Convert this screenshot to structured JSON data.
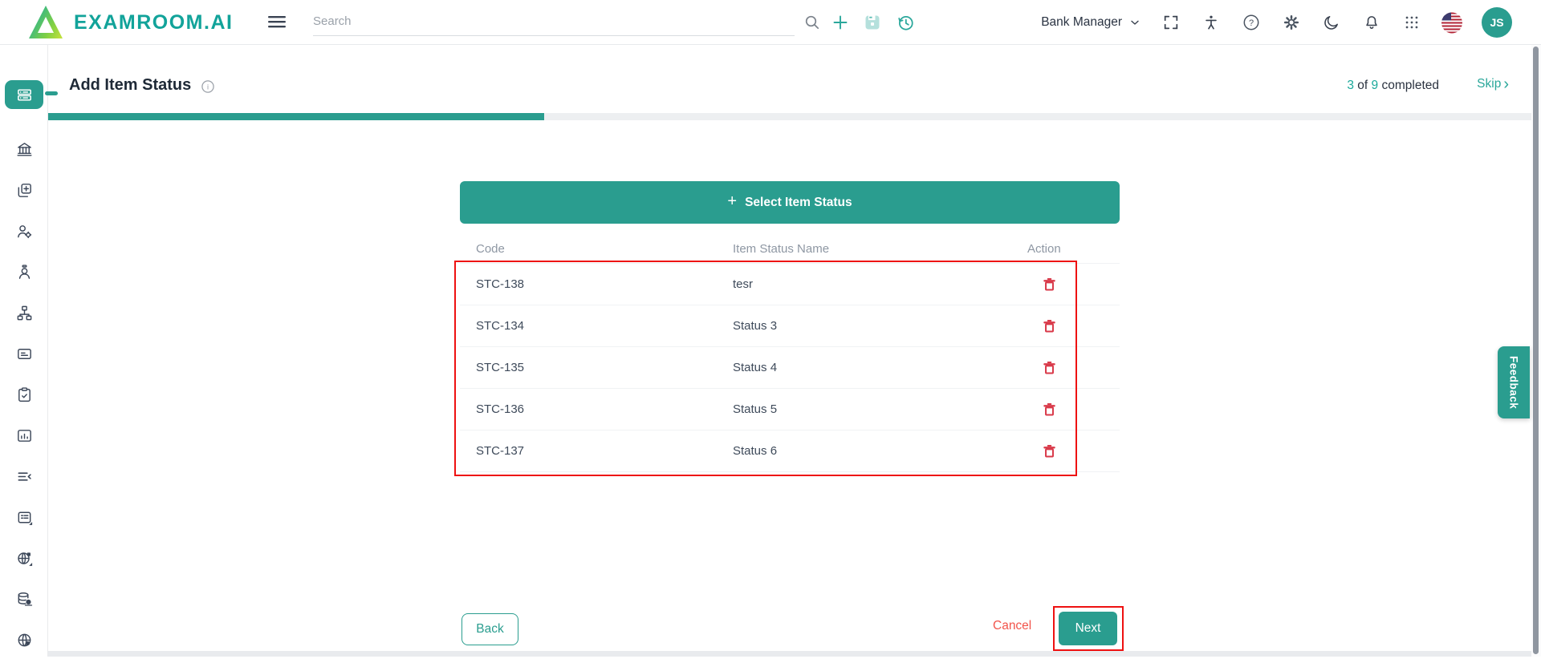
{
  "colors": {
    "accent_teal": "#2a9d8f",
    "logo_teal": "#12a39a",
    "annotation_red": "#ee1111",
    "delete_icon_red": "#d93a4a",
    "cancel_red": "#f2544b"
  },
  "header": {
    "brand": "EXAMROOM.AI",
    "search_placeholder": "Search",
    "role_label": "Bank Manager",
    "avatar_initials": "JS",
    "icons": [
      "menu-icon",
      "search-icon",
      "add-icon",
      "save-icon",
      "history-icon",
      "chevron-down-icon",
      "fullscreen-icon",
      "accessibility-icon",
      "help-icon",
      "settings-icon",
      "dark-mode-icon",
      "notifications-icon",
      "apps-grid-icon",
      "us-flag-icon"
    ]
  },
  "sidebar": {
    "active_index": 0,
    "icons": [
      "item-rows-icon",
      "bank-icon",
      "copy-add-icon",
      "user-settings-icon",
      "user-icon",
      "org-chart-icon",
      "card-icon",
      "clipboard-check-icon",
      "report-chart-icon",
      "collapse-list-icon",
      "form-list-icon",
      "globe-badge-icon",
      "database-icon",
      "globe-icon"
    ]
  },
  "page": {
    "title": "Add Item Status",
    "progress": {
      "current": "3",
      "of_word": "of",
      "total": "9",
      "suffix": "completed",
      "percent": 33
    },
    "skip_label": "Skip"
  },
  "content": {
    "select_button_label": "Select Item Status",
    "table": {
      "columns": [
        "Code",
        "Item Status Name",
        "Action"
      ],
      "rows": [
        {
          "code": "STC-138",
          "name": "tesr"
        },
        {
          "code": "STC-134",
          "name": "Status 3"
        },
        {
          "code": "STC-135",
          "name": "Status 4"
        },
        {
          "code": "STC-136",
          "name": "Status 5"
        },
        {
          "code": "STC-137",
          "name": "Status 6"
        }
      ]
    },
    "footer": {
      "back_label": "Back",
      "cancel_label": "Cancel",
      "next_label": "Next"
    }
  },
  "feedback": {
    "label": "Feedback"
  }
}
